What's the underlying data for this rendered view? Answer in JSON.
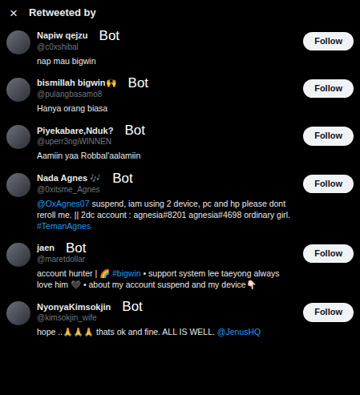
{
  "header": {
    "close": "×",
    "title": "Retweeted by"
  },
  "users": [
    {
      "name": "Napiw qejzu",
      "annotation": "Bot",
      "handle": "@c0xshibal",
      "button": "Follow",
      "bio": [
        {
          "text": "nap mau bigwin",
          "kind": "text"
        }
      ]
    },
    {
      "name": "bismillah bigwin🙌",
      "annotation": "Bot",
      "handle": "@pulangbasamo8",
      "button": "Follow",
      "bio": [
        {
          "text": "Hanya orang biasa",
          "kind": "text"
        }
      ]
    },
    {
      "name": "Piyekabare,Nduk?",
      "annotation": "Bot",
      "handle": "@uperr3ngiWINNEN",
      "button": "Follow",
      "bio": [
        {
          "text": "Aamiin yaa Robbal'aalamiin",
          "kind": "text"
        }
      ]
    },
    {
      "name": "Nada Agnes 🎶",
      "annotation": "Bot",
      "handle": "@0xitsme_Agnes",
      "button": "Follow",
      "bio": [
        {
          "text": "@OxAgnes07",
          "kind": "link"
        },
        {
          "text": " suspend, iam using 2 device, pc and hp please dont reroll me. || 2dc account : agnesia#8201 agnesia#4698 ordinary girl. ",
          "kind": "text"
        },
        {
          "text": "#TemanAgnes",
          "kind": "link"
        }
      ]
    },
    {
      "name": "jaen",
      "annotation": "Bot",
      "handle": "@maretdollar",
      "button": "Follow",
      "bio": [
        {
          "text": "account hunter | 🌈 ",
          "kind": "text"
        },
        {
          "text": "#bigwin",
          "kind": "link"
        },
        {
          "text": " • support system lee taeyong always love him 🖤 • about my account suspend and my device👇🏻",
          "kind": "text"
        }
      ]
    },
    {
      "name": "NyonyaKimsokjin",
      "annotation": "Bot",
      "handle": "@kimsokjin_wife",
      "button": "Follow",
      "bio": [
        {
          "text": "hope ..🙏🙏🙏 thats ok and fine. ALL IS WELL. ",
          "kind": "text"
        },
        {
          "text": "@JenusHQ",
          "kind": "link"
        }
      ]
    }
  ]
}
